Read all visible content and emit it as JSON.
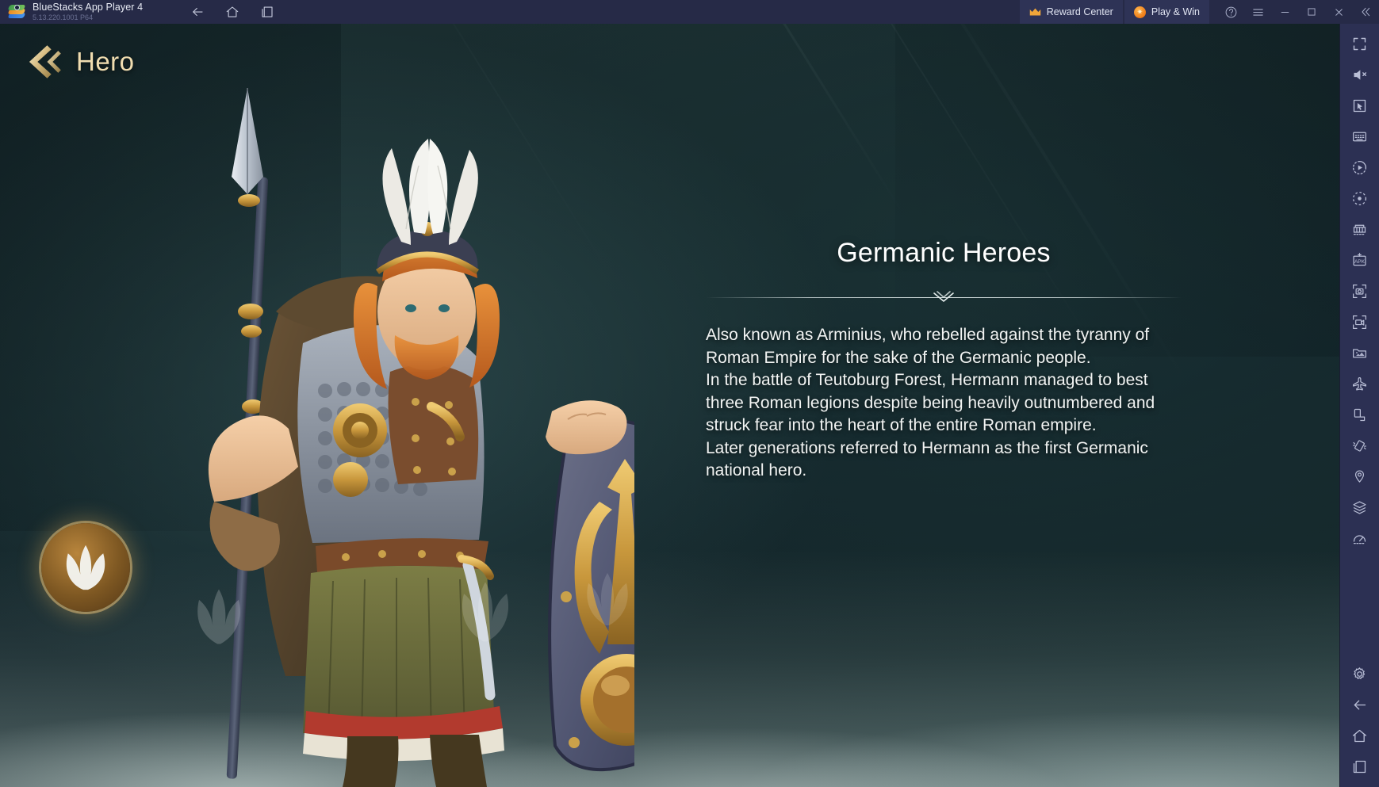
{
  "titlebar": {
    "app_title": "BlueStacks App Player 4",
    "version": "5.13.220.1001 P64",
    "logo_icon": "bluestacks-logo-icon",
    "nav": [
      {
        "name": "back-icon",
        "label": "Back"
      },
      {
        "name": "home-icon",
        "label": "Home"
      },
      {
        "name": "recent-apps-icon",
        "label": "Recent apps"
      }
    ],
    "reward_center_label": "Reward Center",
    "reward_center_icon": "crown-icon",
    "play_and_win_label": "Play & Win",
    "play_and_win_icon": "star-badge-icon",
    "window_controls": [
      {
        "name": "help-icon",
        "label": "Help"
      },
      {
        "name": "hamburger-menu-icon",
        "label": "Menu"
      },
      {
        "name": "minimize-icon",
        "label": "Minimize"
      },
      {
        "name": "maximize-icon",
        "label": "Maximize"
      },
      {
        "name": "close-icon",
        "label": "Close"
      },
      {
        "name": "collapse-chevrons-icon",
        "label": "Collapse"
      }
    ],
    "colors": {
      "bar_bg": "#262a47",
      "pill_bg": "#2e3356",
      "accent_orange": "#ef7c17",
      "text": "#e8ebf4",
      "muted_text": "#6b7193"
    }
  },
  "game": {
    "page_title": "Hero",
    "page_back_icon": "gold-back-chevron-icon",
    "badge_icon": "laurel-wreath-icon",
    "colors": {
      "title_gold": "#f0ddb0",
      "panel_text": "#f2f4f3"
    },
    "info": {
      "title": "Germanic Heroes",
      "divider_icon": "double-chevron-down-ornament",
      "body": "Also known as Arminius, who rebelled against the tyranny of Roman Empire for the sake of the Germanic people.\nIn the battle of Teutoburg Forest, Hermann managed to best three Roman legions despite being heavily outnumbered and struck fear into the heart of the entire Roman empire.\nLater generations referred to Hermann as the first Germanic national hero."
    }
  },
  "sidebar": {
    "items": [
      {
        "name": "fullscreen-icon",
        "label": "Fullscreen"
      },
      {
        "name": "mute-icon",
        "label": "Mute"
      },
      {
        "name": "cursor-icon",
        "label": "Cursor control"
      },
      {
        "name": "keyboard-controls-icon",
        "label": "Game controls"
      },
      {
        "name": "macro-play-icon",
        "label": "Macro recorder"
      },
      {
        "name": "script-record-icon",
        "label": "Script"
      },
      {
        "name": "multi-instance-icon",
        "label": "Multi-instance manager"
      },
      {
        "name": "install-apk-icon",
        "label": "Install APK"
      },
      {
        "name": "screenshot-icon",
        "label": "Screenshot"
      },
      {
        "name": "screen-record-icon",
        "label": "Record screen"
      },
      {
        "name": "media-manager-icon",
        "label": "Media manager"
      },
      {
        "name": "eco-mode-icon",
        "label": "Eco mode"
      },
      {
        "name": "rotate-screen-icon",
        "label": "Rotate"
      },
      {
        "name": "shake-icon",
        "label": "Shake"
      },
      {
        "name": "location-icon",
        "label": "Location"
      },
      {
        "name": "layers-icon",
        "label": "Trim memory"
      },
      {
        "name": "performance-gauge-icon",
        "label": "Performance"
      }
    ],
    "bottom_items": [
      {
        "name": "settings-gear-icon",
        "label": "Settings"
      },
      {
        "name": "back-icon",
        "label": "Back"
      },
      {
        "name": "home-icon",
        "label": "Home"
      },
      {
        "name": "recent-apps-icon",
        "label": "Recent apps"
      }
    ]
  }
}
